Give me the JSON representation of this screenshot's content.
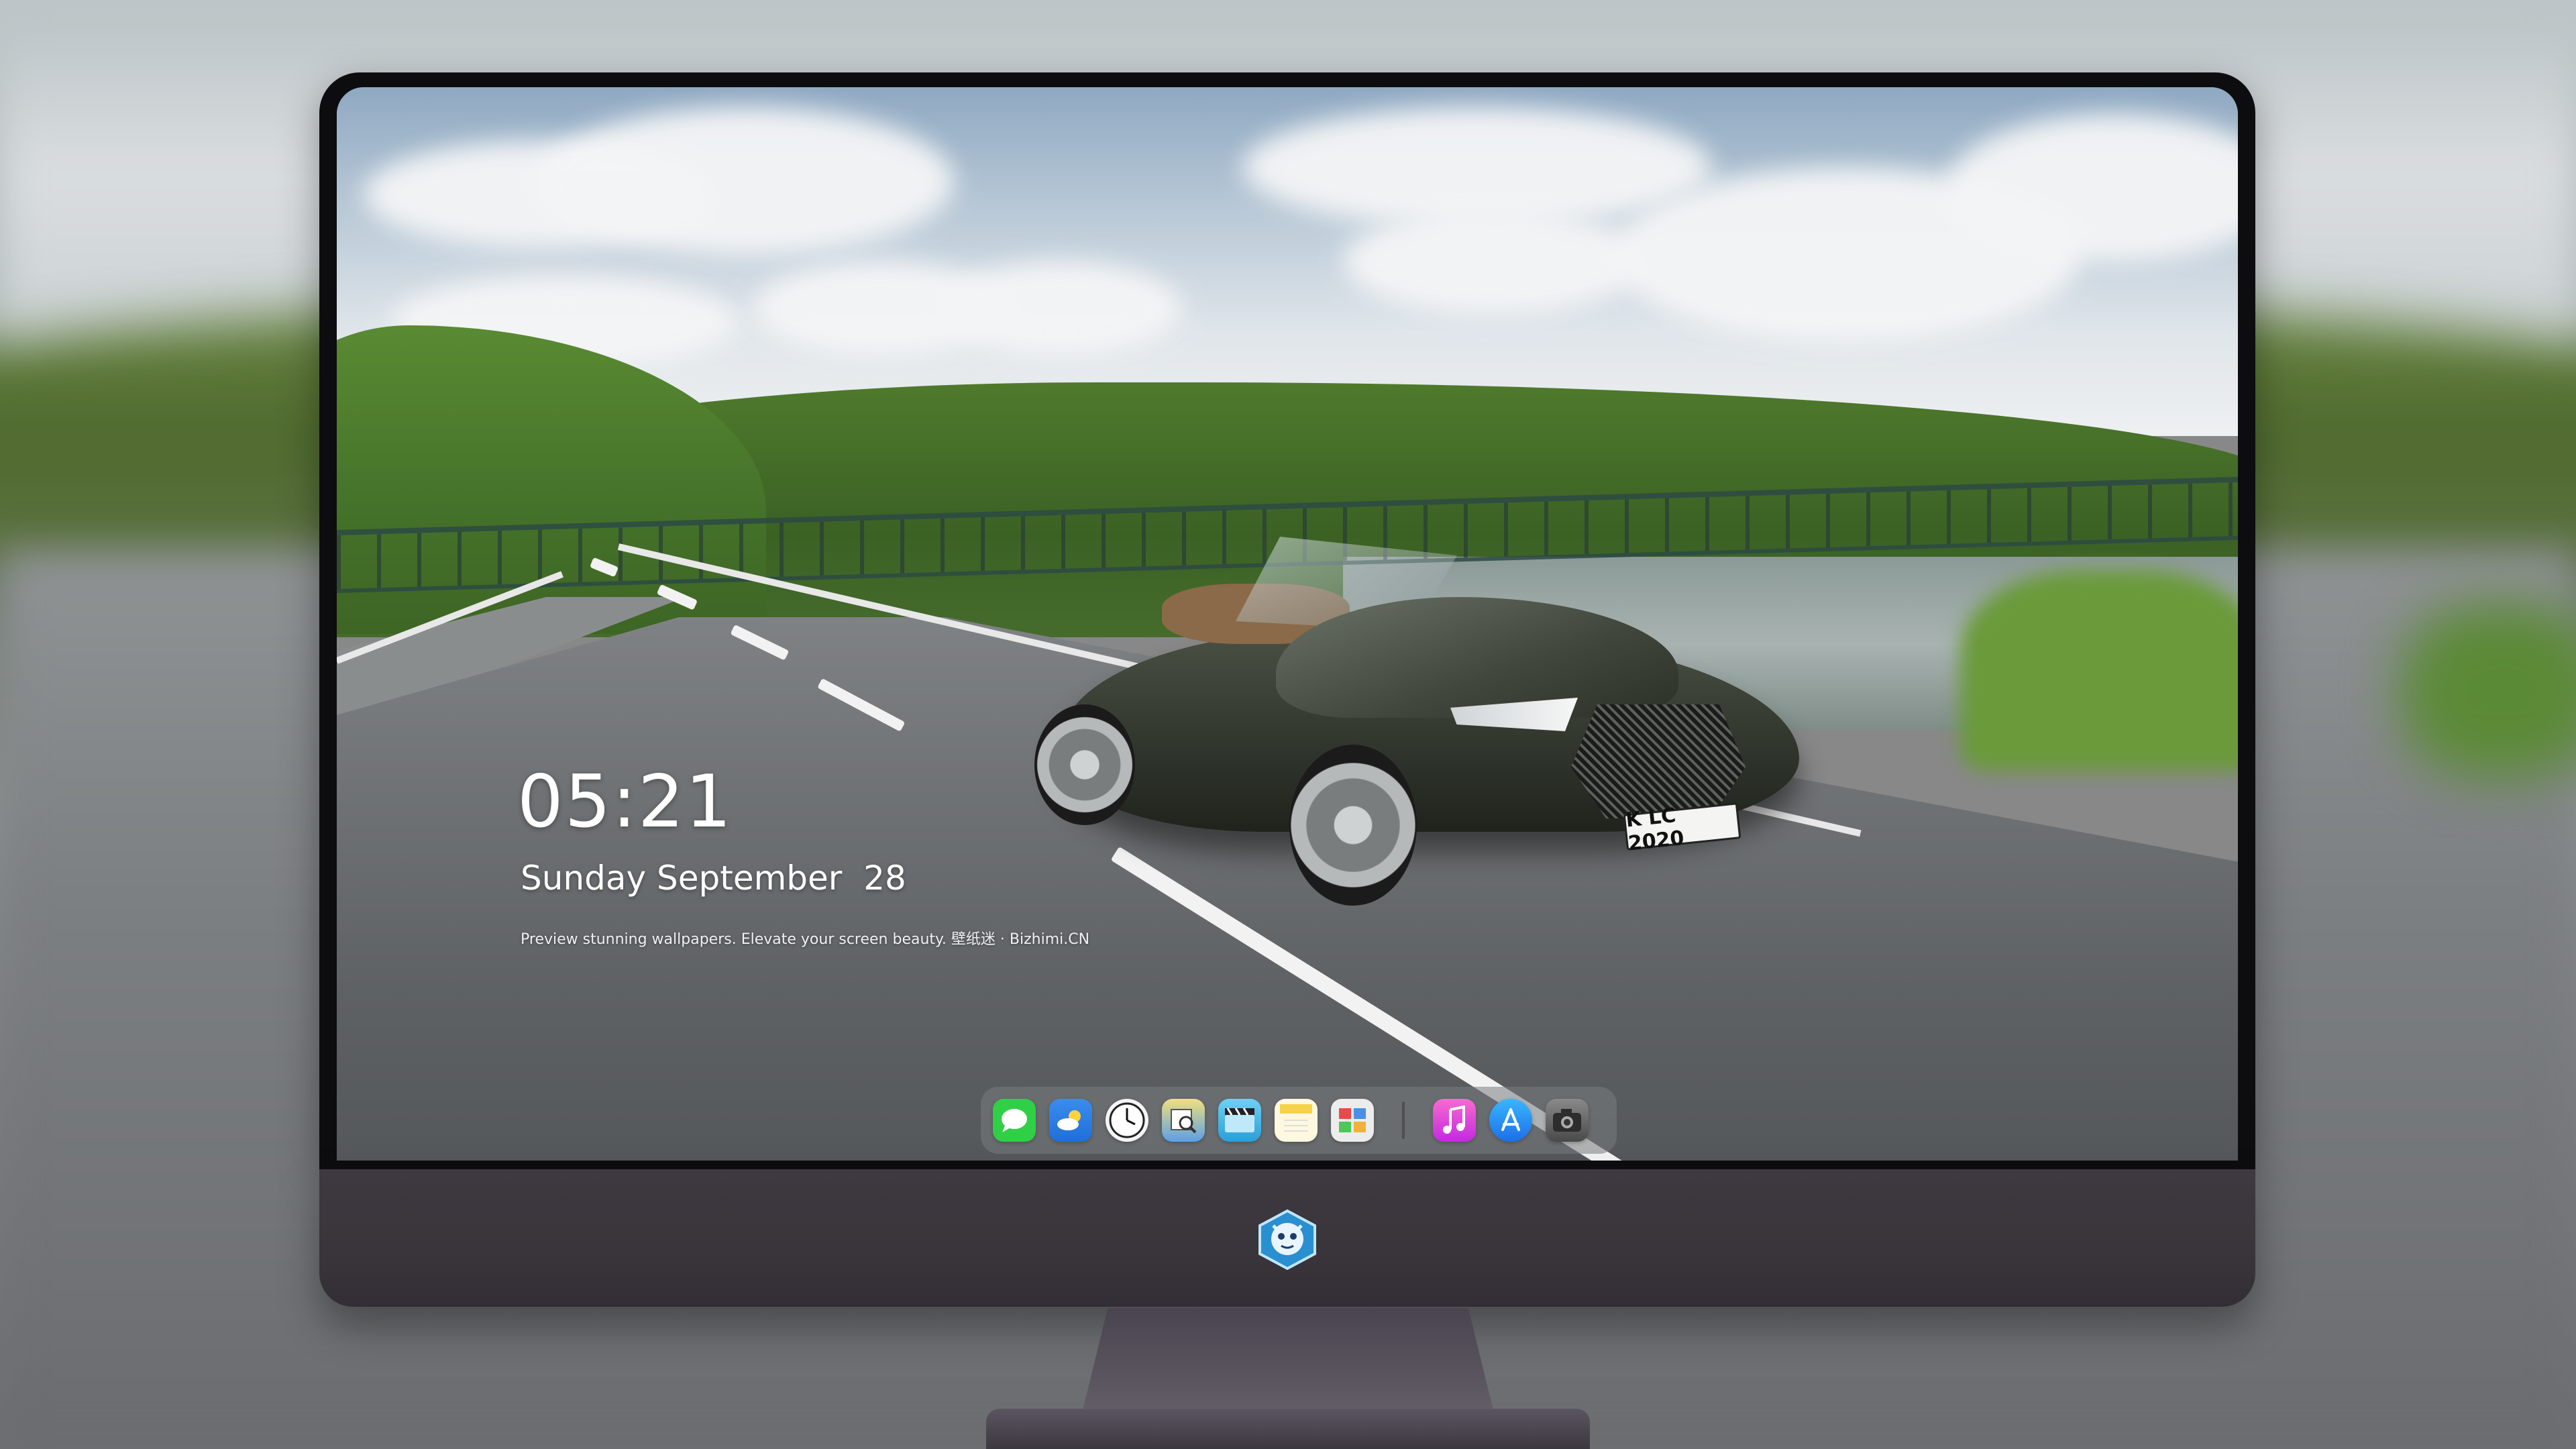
{
  "lockscreen": {
    "time": "05:21",
    "date": "Sunday September  28",
    "tagline": "Preview stunning wallpapers. Elevate your screen beauty. 壁纸迷 · Bizhimi.CN"
  },
  "wallpaper": {
    "license_plate": "K LC 2020"
  },
  "dock": {
    "apps": [
      {
        "name": "messages-icon",
        "glyph": "💬",
        "color": "#2fcf46"
      },
      {
        "name": "weather-icon",
        "glyph": "⛅",
        "color": "#2f7fe8"
      },
      {
        "name": "clock-icon",
        "glyph": "🕔",
        "color": "#f4f4f4"
      },
      {
        "name": "preview-icon",
        "glyph": "🔍",
        "color": "#e6c64a"
      },
      {
        "name": "video-editor-icon",
        "glyph": "🎬",
        "color": "#3ab0e6"
      },
      {
        "name": "notes-icon",
        "glyph": "▤",
        "color": "#f6d24a"
      },
      {
        "name": "photo-browser-icon",
        "glyph": "▦",
        "color": "#e8e8e8"
      },
      {
        "name": "music-icon",
        "glyph": "♫",
        "color": "#e0389a"
      },
      {
        "name": "app-store-icon",
        "glyph": "A",
        "color": "#1f8fff"
      },
      {
        "name": "camera-icon",
        "glyph": "◉",
        "color": "#6a6a6a"
      }
    ]
  },
  "chin": {
    "logo": "mascot-logo-icon"
  }
}
